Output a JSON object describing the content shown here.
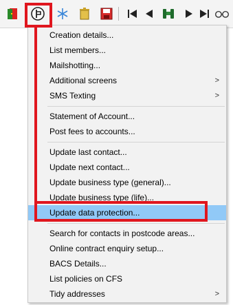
{
  "toolbar": {
    "buttons": [
      {
        "name": "exit-door-icon"
      },
      {
        "name": "actions-menu-icon"
      },
      {
        "name": "snowflake-icon"
      },
      {
        "name": "trash-bin-icon"
      },
      {
        "name": "save-disk-icon"
      },
      {
        "name": "first-record-icon"
      },
      {
        "name": "previous-record-icon"
      },
      {
        "name": "binoculars-search-icon"
      },
      {
        "name": "next-record-icon"
      },
      {
        "name": "last-record-icon"
      },
      {
        "name": "glasses-view-icon"
      }
    ]
  },
  "menu": {
    "groups": [
      [
        {
          "label": "Creation details...",
          "submenu": false
        },
        {
          "label": "List members...",
          "submenu": false
        },
        {
          "label": "Mailshotting...",
          "submenu": false
        },
        {
          "label": "Additional screens",
          "submenu": true
        },
        {
          "label": "SMS Texting",
          "submenu": true
        }
      ],
      [
        {
          "label": "Statement of Account...",
          "submenu": false
        },
        {
          "label": "Post fees to accounts...",
          "submenu": false
        }
      ],
      [
        {
          "label": "Update last contact...",
          "submenu": false
        },
        {
          "label": "Update next contact...",
          "submenu": false
        },
        {
          "label": "Update business type (general)...",
          "submenu": false
        },
        {
          "label": "Update business type (life)...",
          "submenu": false
        },
        {
          "label": "Update data protection...",
          "submenu": false,
          "selected": true
        }
      ],
      [
        {
          "label": "Search for contacts in postcode areas...",
          "submenu": false
        },
        {
          "label": "Online contract enquiry setup...",
          "submenu": false
        },
        {
          "label": "BACS Details...",
          "submenu": false
        },
        {
          "label": "List policies on CFS",
          "submenu": false
        },
        {
          "label": "Tidy addresses",
          "submenu": true
        }
      ]
    ],
    "submenu_arrow": ">"
  },
  "colors": {
    "highlight": "#e0161e",
    "selected_row": "#91c9f7"
  }
}
